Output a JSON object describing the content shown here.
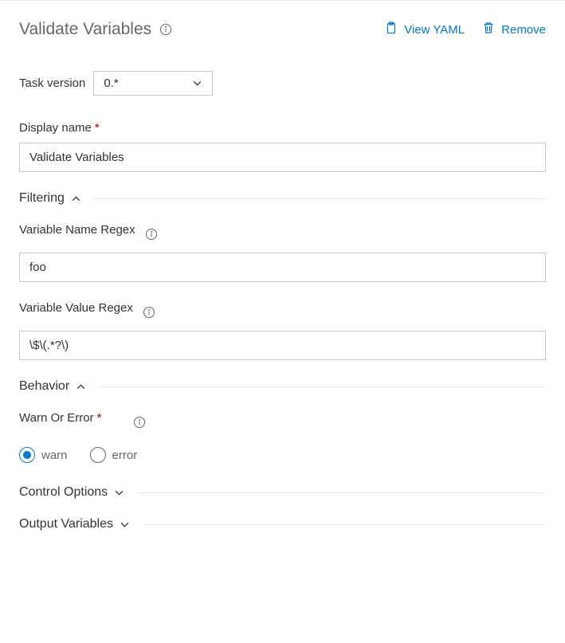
{
  "header": {
    "title": "Validate Variables",
    "view_yaml": "View YAML",
    "remove": "Remove"
  },
  "task_version": {
    "label": "Task version",
    "value": "0.*"
  },
  "display_name": {
    "label": "Display name",
    "value": "Validate Variables"
  },
  "sections": {
    "filtering": "Filtering",
    "behavior": "Behavior",
    "control_options": "Control Options",
    "output_variables": "Output Variables"
  },
  "var_name_regex": {
    "label": "Variable Name Regex",
    "value": "foo"
  },
  "var_value_regex": {
    "label": "Variable Value Regex",
    "value": "\\$\\(.*?\\)"
  },
  "warn_or_error": {
    "label": "Warn Or Error",
    "warn": "warn",
    "error": "error"
  }
}
